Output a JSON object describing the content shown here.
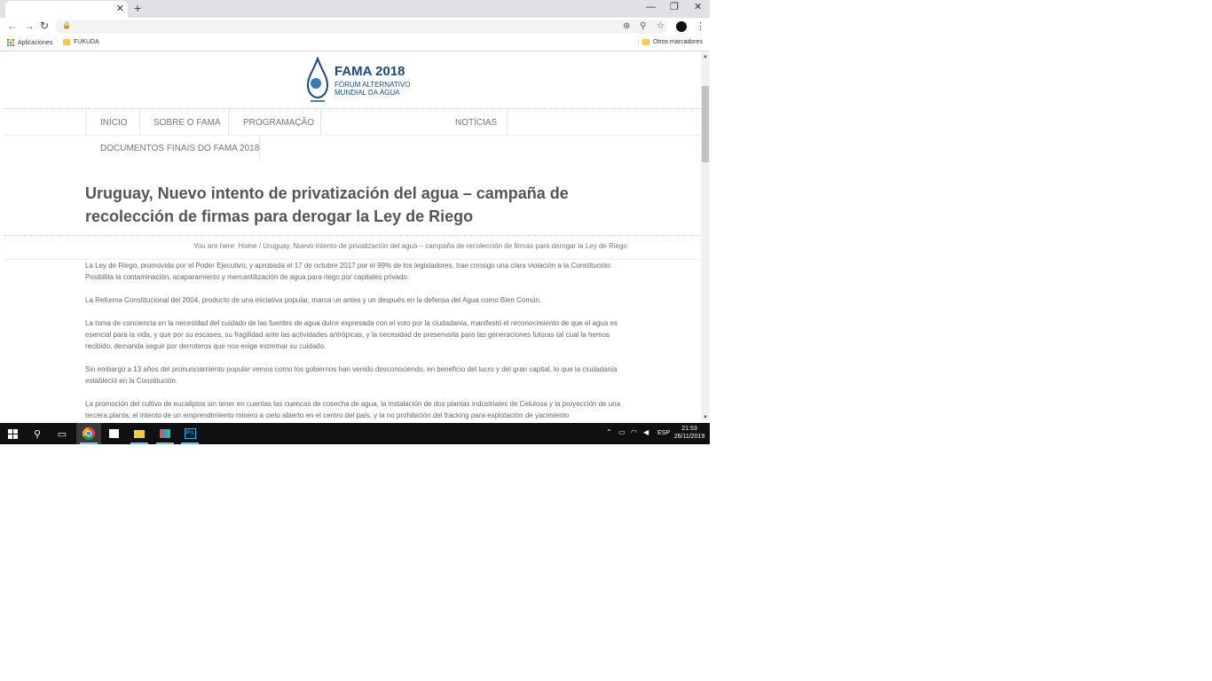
{
  "browser": {
    "tab": {
      "close": "✕"
    },
    "new_tab": "+",
    "window": {
      "minimize": "—",
      "restore": "❐",
      "close": "✕"
    },
    "bookmarks": {
      "apps": "Aplicaciones",
      "folder1": "FUKUDA",
      "other": "Otros marcadores"
    }
  },
  "site": {
    "logo": {
      "title": "FAMA 2018",
      "line1": "FÓRUM ALTERNATIVO",
      "line2": "MUNDIAL DA ÁGUA"
    },
    "menu": {
      "inicio": "INÍCIO",
      "sobre": "SOBRE O FAMA",
      "programacao": "PROGRAMAÇÃO",
      "noticias": "NOTÍCIAS",
      "documentos": "DOCUMENTOS FINAIS DO FAMA 2018"
    },
    "post_title": "Uruguay, Nuevo intento de privatización del agua – campaña de recolección de firmas para derogar la Ley de Riego",
    "breadcrumb": "You are here: Home / Uruguay, Nuevo intento de privatización del agua – campaña de recolección de firmas para derogar la Ley de Riego",
    "paragraphs": [
      "La Ley de Riego, promovida por el Poder Ejecutivo, y aprobada el 17 de octubre 2017 por el 99% de los legisladores, trae consigo una clara violación a la Constitución. Posibilita la contaminación, acaparamiento y mercantilización de agua para riego por capitales privado.",
      "La Reforma Constitucional del 2004, producto de una iniciativa popular, marca un antes y un después en la defensa del Agua como Bien Común.",
      "La toma de conciencia en la necesidad del cuidado de las fuentes de agua dulce expresada con el voto por la ciudadanía, manifestó el reconocimiento de que el agua es esencial para la vida, y que por su escases, su fragilidad ante las actividades antrópicas, y la necesidad de preservarla para las generaciones futuras tal cual la hemos recibido, demanda seguir por derroteros que nos exige extremar su cuidado.",
      "Sin embargo a 13 años del pronunciamiento popular vemos como los gobiernos han venido desconociendo, en beneficio del lucro y del gran capital, lo que la ciudadanía estableció en la Constitución.",
      "La promoción del cultivo de eucaliptos sin tener en cuentas las cuencas de cosecha de agua, la instalación de dos plantas industriales de Celulosa y la proyección de una tercera planta; el intento de un emprendimiento minero a cielo abierto en el centro del país, y la no prohibición del fracking para explotación de yacimiento"
    ]
  },
  "taskbar": {
    "language": "ESP",
    "time": "21:53",
    "date": "26/11/2019"
  }
}
